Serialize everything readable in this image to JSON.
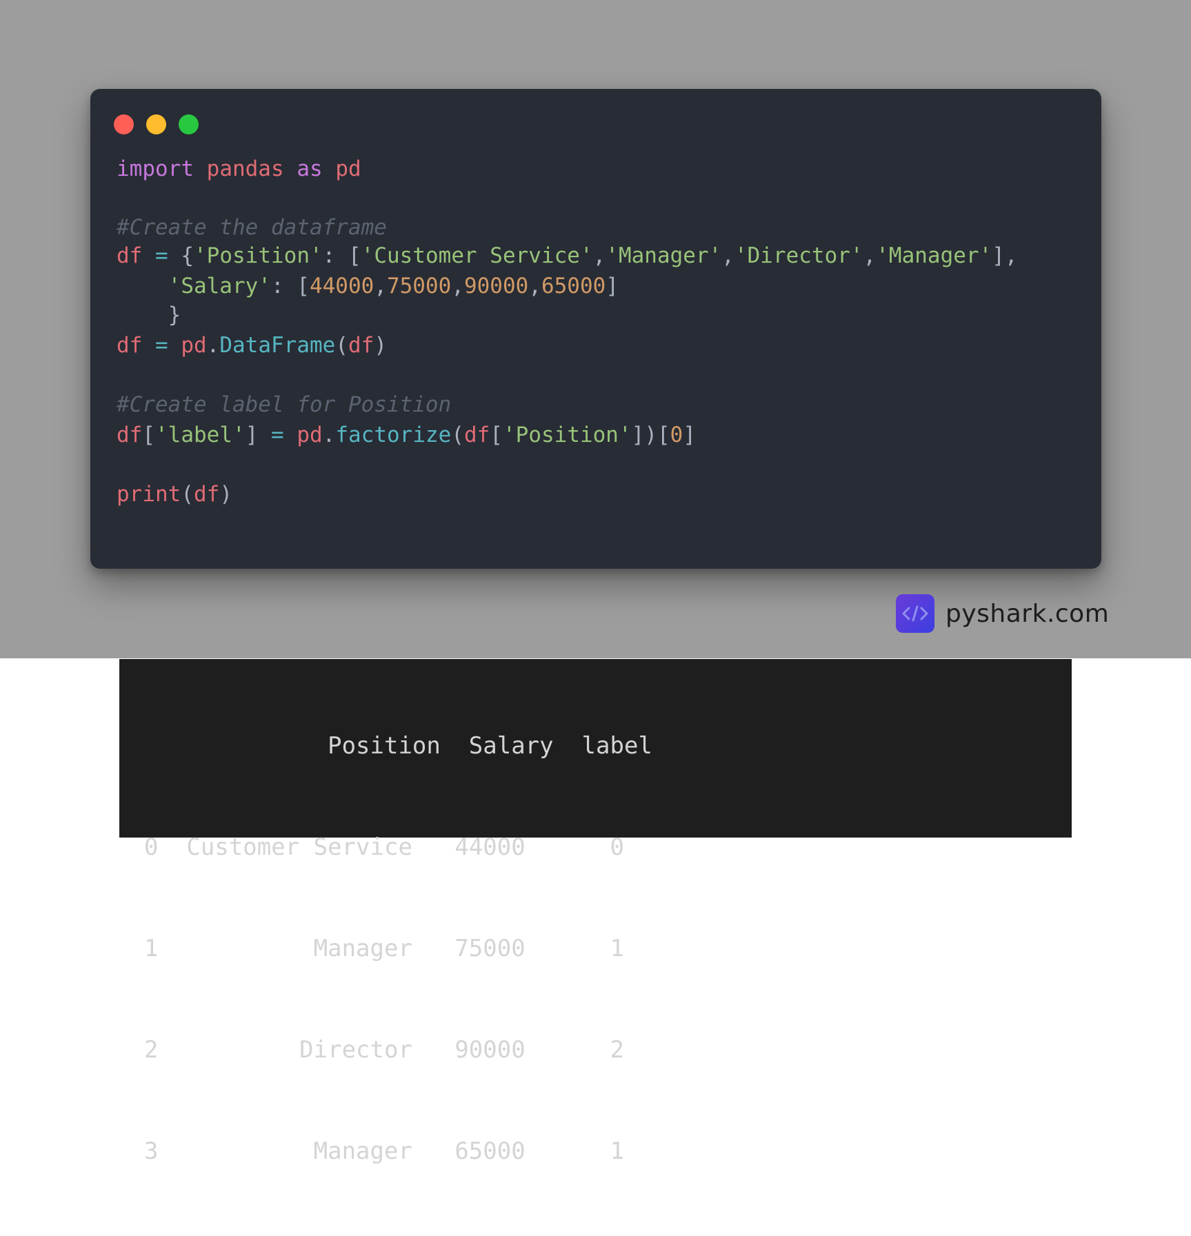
{
  "code_window": {
    "controls": [
      "close",
      "minimize",
      "maximize"
    ],
    "lines": [
      "import pandas as pd",
      "",
      "#Create the dataframe",
      "df = {'Position': ['Customer Service','Manager','Director','Manager'],",
      "    'Salary': [44000,75000,90000,65000]",
      "    }",
      "df = pd.DataFrame(df)",
      "",
      "#Create label for Position",
      "df['label'] = pd.factorize(df['Position'])[0]",
      "",
      "print(df)"
    ]
  },
  "brand": {
    "icon": "code-brackets-icon",
    "icon_glyph": "</>",
    "text": "pyshark.com"
  },
  "output": {
    "columns": [
      "Position",
      "Salary",
      "label"
    ],
    "rows": [
      {
        "index": "0",
        "Position": "Customer Service",
        "Salary": "44000",
        "label": "0"
      },
      {
        "index": "1",
        "Position": "Manager",
        "Salary": "75000",
        "label": "1"
      },
      {
        "index": "2",
        "Position": "Director",
        "Salary": "90000",
        "label": "2"
      },
      {
        "index": "3",
        "Position": "Manager",
        "Salary": "65000",
        "label": "1"
      }
    ],
    "text_lines": [
      "             Position  Salary  label",
      "0  Customer Service   44000      0",
      "1           Manager   75000      1",
      "2          Director   90000      2",
      "3           Manager   65000      1"
    ]
  },
  "colors": {
    "backdrop": "#9d9d9d",
    "editor_bg": "#282c35",
    "terminal_bg": "#1e1e1e",
    "keyword": "#c678dd",
    "variable": "#e06c75",
    "string": "#98c379",
    "number": "#d19a66",
    "function": "#56b6c2",
    "comment": "#5c6370"
  }
}
